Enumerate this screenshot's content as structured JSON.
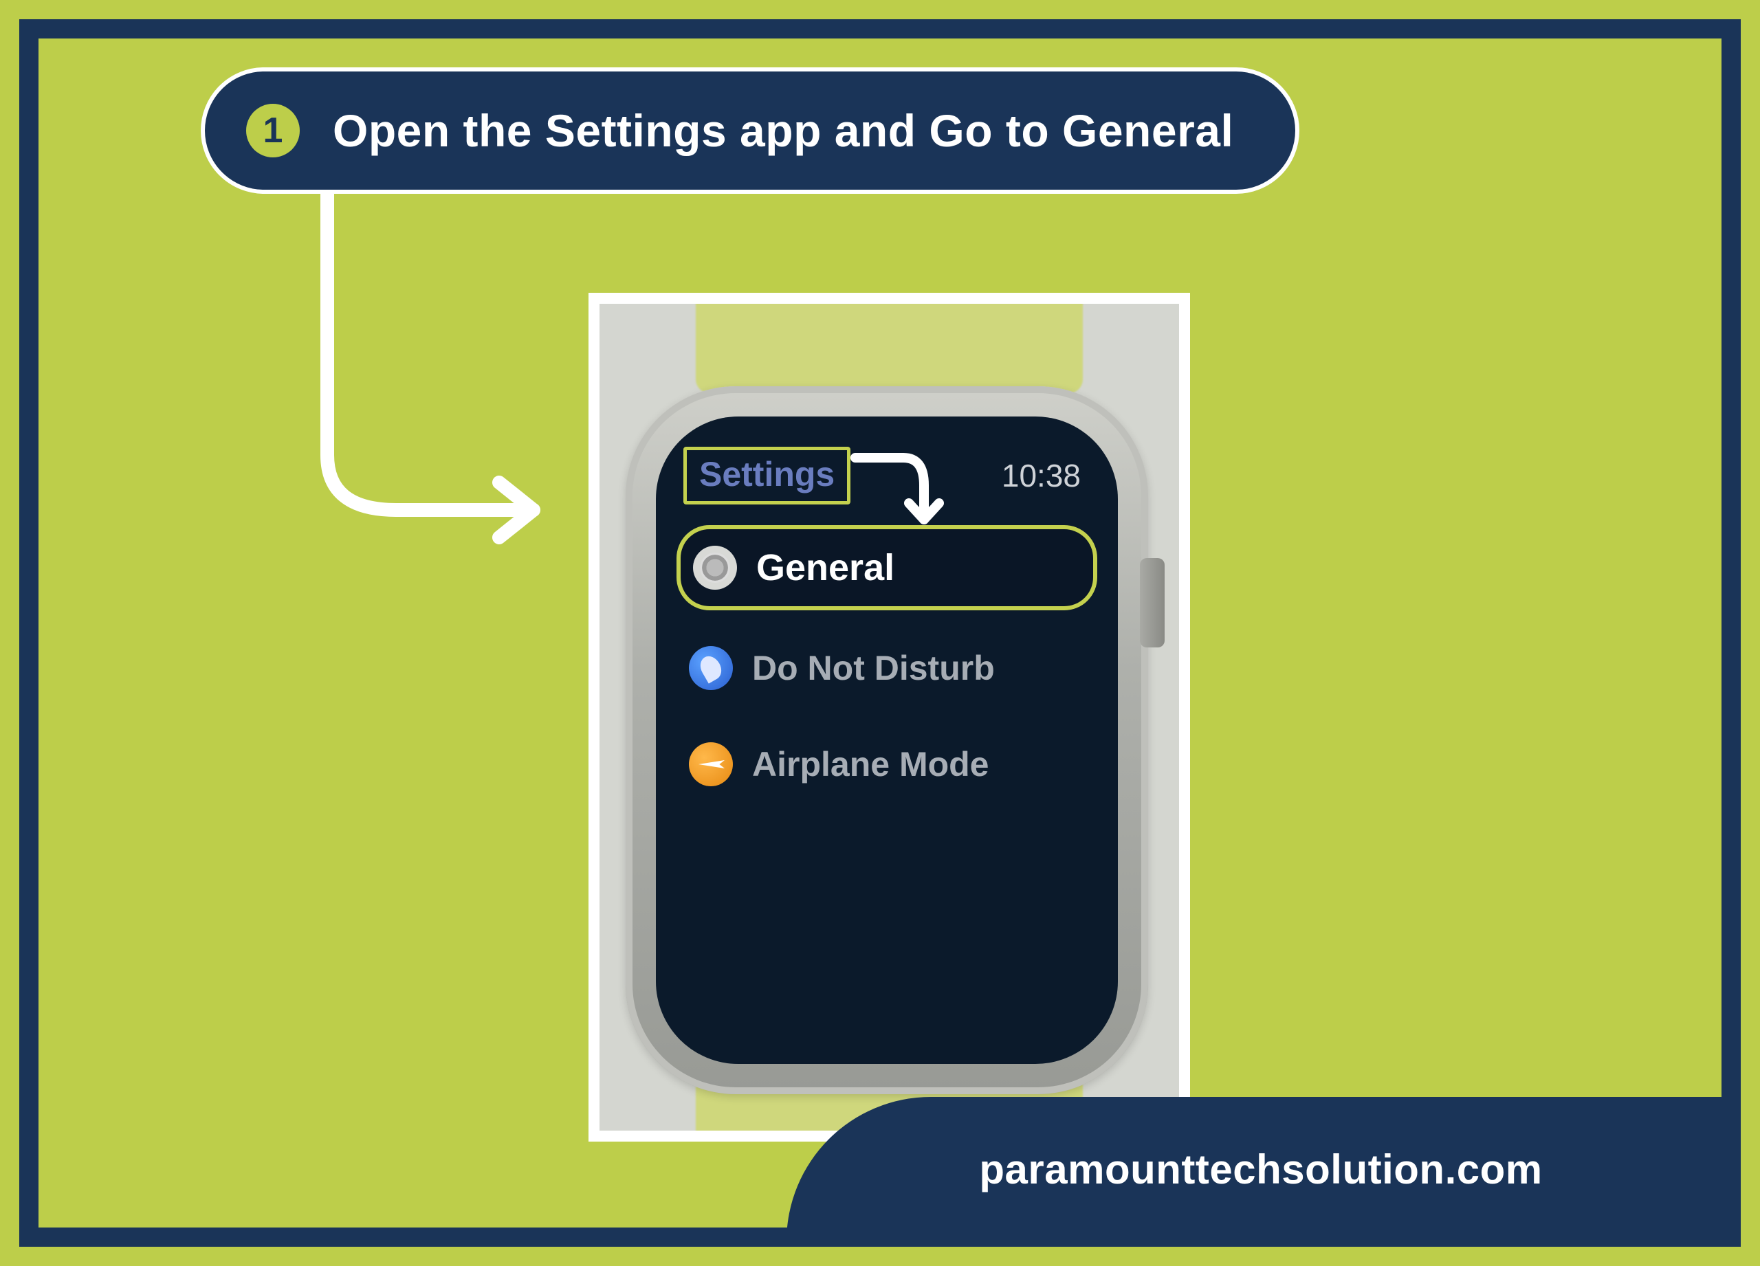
{
  "step": {
    "number": "1",
    "title": "Open the Settings app and Go to General"
  },
  "watch": {
    "header_label": "Settings",
    "time": "10:38",
    "menu": {
      "general": "General",
      "dnd": "Do Not Disturb",
      "airplane": "Airplane Mode"
    }
  },
  "footer": {
    "website": "paramounttechsolution.com"
  },
  "colors": {
    "bg": "#bdce4a",
    "navy": "#1a3458",
    "highlight": "#c4d14e"
  }
}
